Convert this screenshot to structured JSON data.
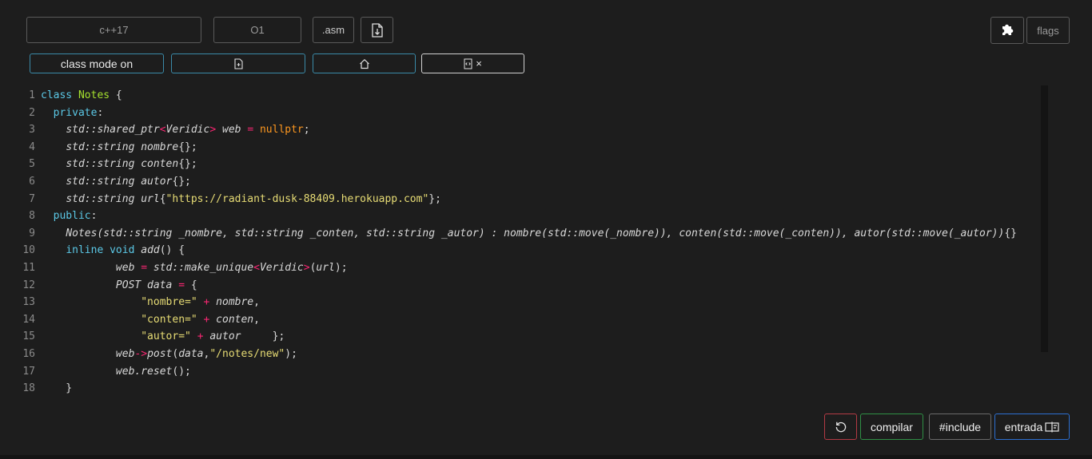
{
  "toolbar": {
    "standard": "c++17",
    "optimization": "O1",
    "asm_label": ".asm",
    "flags_label": "flags"
  },
  "secondary_toolbar": {
    "class_mode_label": "class mode on",
    "close_glyph": "×"
  },
  "editor": {
    "lines": [
      {
        "n": "1",
        "tokens": [
          {
            "t": "class",
            "c": "kw"
          },
          {
            "t": " "
          },
          {
            "t": "Notes",
            "c": "cls"
          },
          {
            "t": " {"
          }
        ]
      },
      {
        "n": "2",
        "tokens": [
          {
            "t": "  "
          },
          {
            "t": "private",
            "c": "kw"
          },
          {
            "t": ":"
          }
        ]
      },
      {
        "n": "3",
        "tokens": [
          {
            "t": "    "
          },
          {
            "t": "std::shared_ptr",
            "c": "it"
          },
          {
            "t": "<",
            "c": "op"
          },
          {
            "t": "Veridic",
            "c": "it"
          },
          {
            "t": ">",
            "c": "op"
          },
          {
            "t": " "
          },
          {
            "t": "web",
            "c": "it"
          },
          {
            "t": " "
          },
          {
            "t": "=",
            "c": "op"
          },
          {
            "t": " "
          },
          {
            "t": "nullptr",
            "c": "num"
          },
          {
            "t": ";"
          }
        ]
      },
      {
        "n": "4",
        "tokens": [
          {
            "t": "    "
          },
          {
            "t": "std::string nombre",
            "c": "it"
          },
          {
            "t": "{};"
          }
        ]
      },
      {
        "n": "5",
        "tokens": [
          {
            "t": "    "
          },
          {
            "t": "std::string conten",
            "c": "it"
          },
          {
            "t": "{};"
          }
        ]
      },
      {
        "n": "6",
        "tokens": [
          {
            "t": "    "
          },
          {
            "t": "std::string autor",
            "c": "it"
          },
          {
            "t": "{};"
          }
        ]
      },
      {
        "n": "7",
        "tokens": [
          {
            "t": "    "
          },
          {
            "t": "std::string url",
            "c": "it"
          },
          {
            "t": "{"
          },
          {
            "t": "\"https://radiant-dusk-88409.herokuapp.com\"",
            "c": "str"
          },
          {
            "t": "};"
          }
        ]
      },
      {
        "n": "8",
        "tokens": [
          {
            "t": "  "
          },
          {
            "t": "public",
            "c": "kw"
          },
          {
            "t": ":"
          }
        ]
      },
      {
        "n": "9",
        "tokens": [
          {
            "t": "    "
          },
          {
            "t": "Notes(std::string _nombre, std::string _conten, std::string _autor) : nombre(std::move(_nombre)), conten(std::move(_conten)), autor(std::move(_autor))",
            "c": "it"
          },
          {
            "t": "{}"
          }
        ]
      },
      {
        "n": "10",
        "tokens": [
          {
            "t": "    "
          },
          {
            "t": "inline",
            "c": "kw"
          },
          {
            "t": " "
          },
          {
            "t": "void",
            "c": "kw"
          },
          {
            "t": " "
          },
          {
            "t": "add",
            "c": "it"
          },
          {
            "t": "() {"
          }
        ]
      },
      {
        "n": "11",
        "tokens": [
          {
            "t": "            "
          },
          {
            "t": "web",
            "c": "it"
          },
          {
            "t": " "
          },
          {
            "t": "=",
            "c": "op"
          },
          {
            "t": " "
          },
          {
            "t": "std::make_unique",
            "c": "it"
          },
          {
            "t": "<",
            "c": "op"
          },
          {
            "t": "Veridic",
            "c": "it"
          },
          {
            "t": ">",
            "c": "op"
          },
          {
            "t": "("
          },
          {
            "t": "url",
            "c": "it"
          },
          {
            "t": ");"
          }
        ]
      },
      {
        "n": "12",
        "tokens": [
          {
            "t": "            "
          },
          {
            "t": "POST data",
            "c": "it"
          },
          {
            "t": " "
          },
          {
            "t": "=",
            "c": "op"
          },
          {
            "t": " {"
          }
        ]
      },
      {
        "n": "13",
        "tokens": [
          {
            "t": "                "
          },
          {
            "t": "\"nombre=\"",
            "c": "str"
          },
          {
            "t": " "
          },
          {
            "t": "+",
            "c": "op"
          },
          {
            "t": " "
          },
          {
            "t": "nombre",
            "c": "it"
          },
          {
            "t": ","
          }
        ]
      },
      {
        "n": "14",
        "tokens": [
          {
            "t": "                "
          },
          {
            "t": "\"conten=\"",
            "c": "str"
          },
          {
            "t": " "
          },
          {
            "t": "+",
            "c": "op"
          },
          {
            "t": " "
          },
          {
            "t": "conten",
            "c": "it"
          },
          {
            "t": ","
          }
        ]
      },
      {
        "n": "15",
        "tokens": [
          {
            "t": "                "
          },
          {
            "t": "\"autor=\"",
            "c": "str"
          },
          {
            "t": " "
          },
          {
            "t": "+",
            "c": "op"
          },
          {
            "t": " "
          },
          {
            "t": "autor",
            "c": "it"
          },
          {
            "t": "     };"
          }
        ]
      },
      {
        "n": "16",
        "tokens": [
          {
            "t": "            "
          },
          {
            "t": "web",
            "c": "it"
          },
          {
            "t": "->",
            "c": "op"
          },
          {
            "t": "post",
            "c": "it"
          },
          {
            "t": "("
          },
          {
            "t": "data",
            "c": "it"
          },
          {
            "t": ","
          },
          {
            "t": "\"/notes/new\"",
            "c": "str"
          },
          {
            "t": ");"
          }
        ]
      },
      {
        "n": "17",
        "tokens": [
          {
            "t": "            "
          },
          {
            "t": "web.reset",
            "c": "it"
          },
          {
            "t": "();"
          }
        ]
      },
      {
        "n": "18",
        "tokens": [
          {
            "t": "    }"
          }
        ]
      }
    ]
  },
  "actions": {
    "compile_label": "compilar",
    "include_label": "#include",
    "input_label": "entrada"
  }
}
